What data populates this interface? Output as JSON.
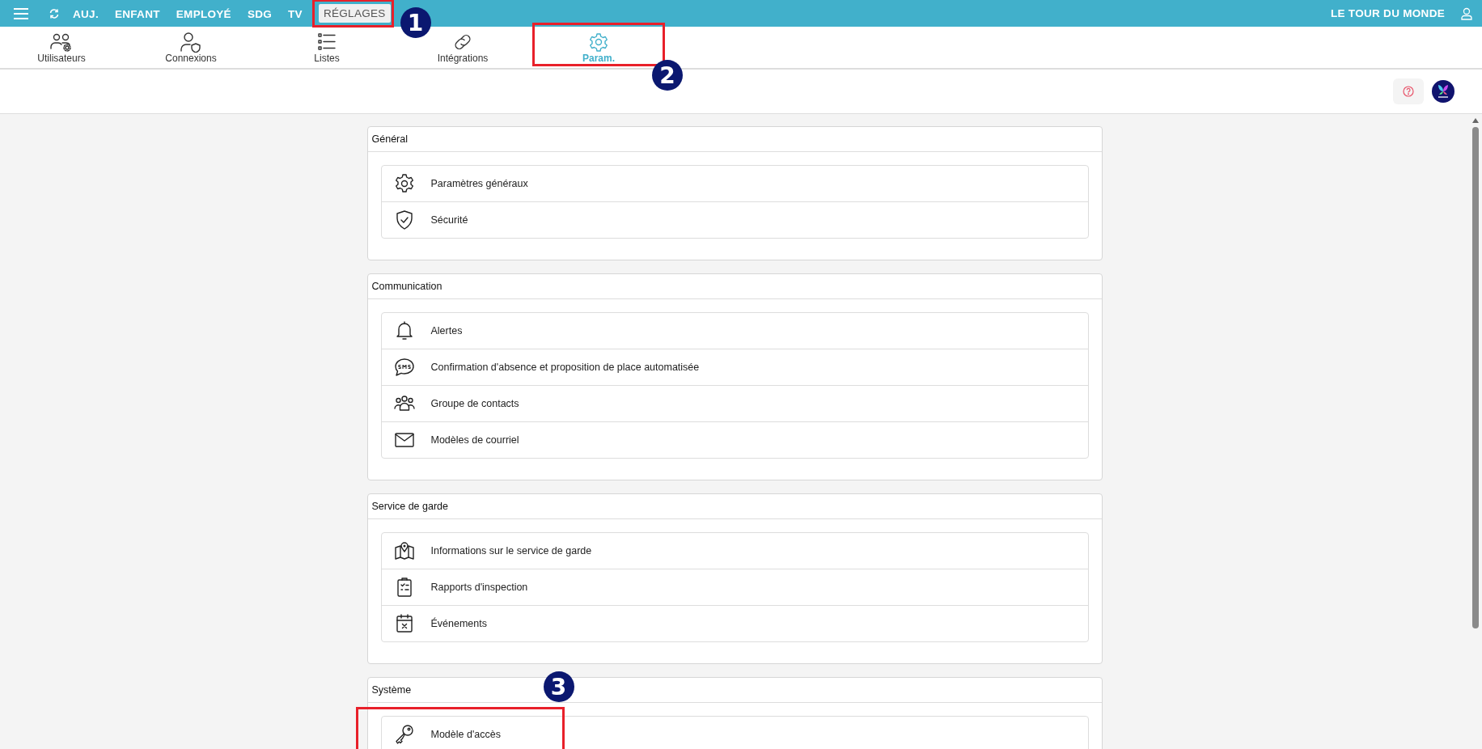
{
  "top_menu": [
    {
      "label": "AUJ.",
      "selected": false
    },
    {
      "label": "ENFANT",
      "selected": false
    },
    {
      "label": "EMPLOYÉ",
      "selected": false
    },
    {
      "label": "SDG",
      "selected": false
    },
    {
      "label": "TV",
      "selected": false
    },
    {
      "label": "RÉGLAGES",
      "selected": true,
      "callout": "1"
    }
  ],
  "org_name": "LE TOUR DU MONDE",
  "tabs": [
    {
      "label": "Utilisateurs",
      "selected": false
    },
    {
      "label": "Connexions",
      "selected": false
    },
    {
      "label": "Listes",
      "selected": false
    },
    {
      "label": "Intégrations",
      "selected": false
    },
    {
      "label": "Param.",
      "selected": true,
      "callout": "2"
    }
  ],
  "sections": [
    {
      "title": "Général",
      "items": [
        {
          "label": "Paramètres généraux"
        },
        {
          "label": "Sécurité"
        }
      ]
    },
    {
      "title": "Communication",
      "items": [
        {
          "label": "Alertes"
        },
        {
          "label": "Confirmation d'absence et proposition de place automatisée"
        },
        {
          "label": "Groupe de contacts"
        },
        {
          "label": "Modèles de courriel"
        }
      ]
    },
    {
      "title": "Service de garde",
      "items": [
        {
          "label": "Informations sur le service de garde"
        },
        {
          "label": "Rapports d'inspection"
        },
        {
          "label": "Événements"
        }
      ]
    },
    {
      "title": "Système",
      "items": [
        {
          "label": "Modèle d'accès",
          "callout": "3"
        }
      ]
    }
  ]
}
